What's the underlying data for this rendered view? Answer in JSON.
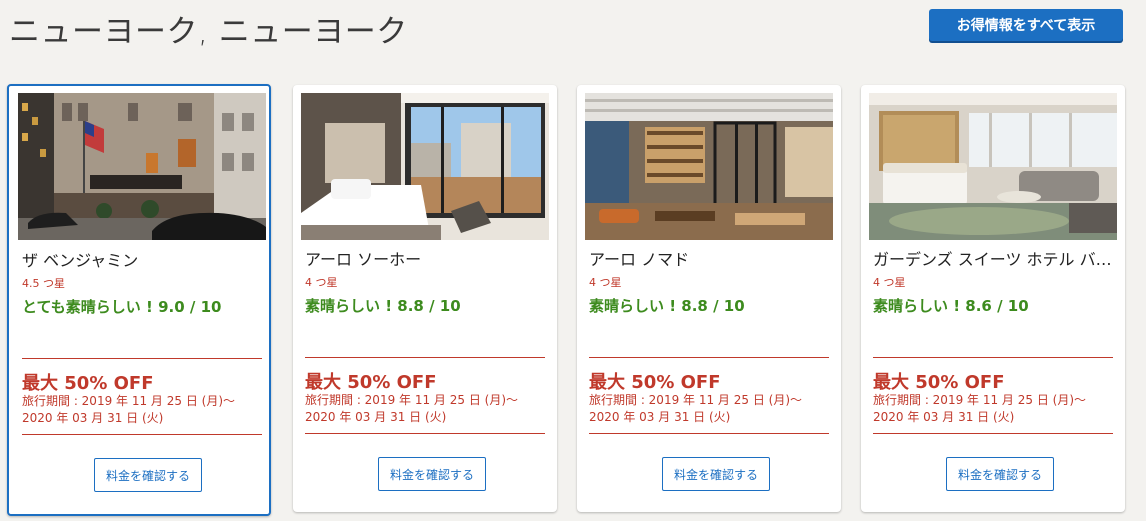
{
  "header": {
    "title": "ニューヨーク, ニューヨーク",
    "deals_button": "お得情報をすべて表示"
  },
  "hotels": [
    {
      "name": "ザ ベンジャミン",
      "stars": "4.5 つ星",
      "rating": "とても素晴らしい ! 9.0 / 10",
      "discount": "最大 50% OFF",
      "period_start": "旅行期間 : 2019 年 11 月 25 日 (月)～",
      "period_end": "2020 年 03 月 31 日 (火)",
      "button": "料金を確認する"
    },
    {
      "name": "アーロ ソーホー",
      "stars": "4 つ星",
      "rating": "素晴らしい ! 8.8 / 10",
      "discount": "最大 50% OFF",
      "period_start": "旅行期間 : 2019 年 11 月 25 日 (月)～",
      "period_end": "2020 年 03 月 31 日 (火)",
      "button": "料金を確認する"
    },
    {
      "name": "アーロ ノマド",
      "stars": "4 つ星",
      "rating": "素晴らしい ! 8.8 / 10",
      "discount": "最大 50% OFF",
      "period_start": "旅行期間 : 2019 年 11 月 25 日 (月)～",
      "period_end": "2020 年 03 月 31 日 (火)",
      "button": "料金を確認する"
    },
    {
      "name": "ガーデンズ スイーツ ホテル バ…",
      "stars": "4 つ星",
      "rating": "素晴らしい ! 8.6 / 10",
      "discount": "最大 50% OFF",
      "period_start": "旅行期間 : 2019 年 11 月 25 日 (月)～",
      "period_end": "2020 年 03 月 31 日 (火)",
      "button": "料金を確認する"
    }
  ],
  "colors": {
    "accent": "#1c6fc2",
    "discount": "#c0392b",
    "rating": "#3d8b1e"
  }
}
